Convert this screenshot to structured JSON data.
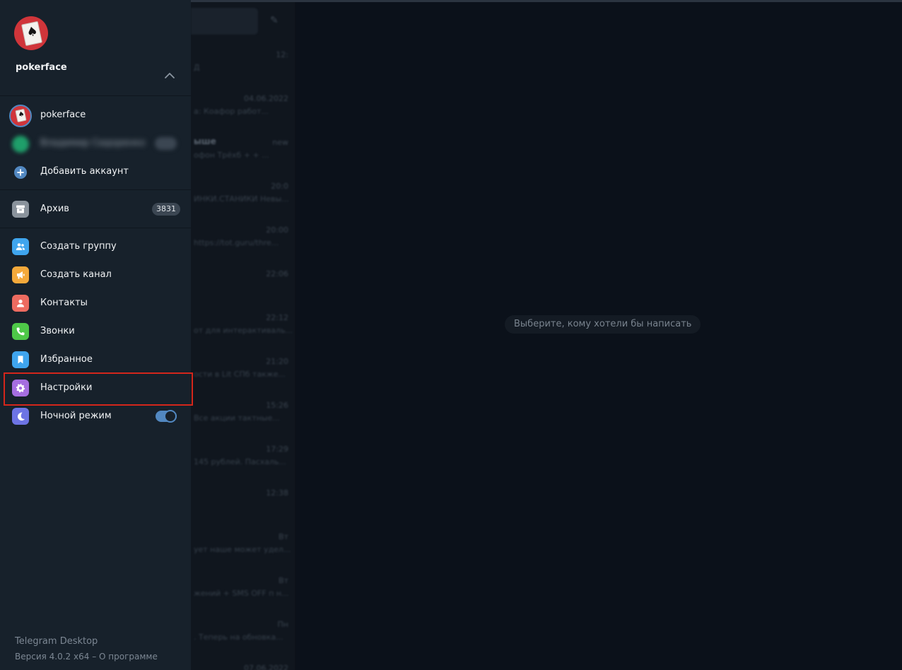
{
  "app": {
    "title": "Telegram Desktop"
  },
  "drawer": {
    "header": {
      "name": "pokerface"
    },
    "accounts": [
      {
        "name": "pokerface"
      },
      {
        "name": "Владимир Сидоренко",
        "badge": "288"
      }
    ],
    "add_account": "Добавить аккаунт",
    "archive": {
      "label": "Архив",
      "count": "3831"
    },
    "menu": {
      "new_group": "Создать группу",
      "new_channel": "Создать канал",
      "contacts": "Контакты",
      "calls": "Звонки",
      "saved": "Избранное",
      "settings": "Настройки",
      "night_mode": "Ночной режим"
    },
    "night_mode_on": true,
    "footer": {
      "title": "Telegram Desktop",
      "version_prefix": "Версия 4.0.2 x64 – ",
      "about": "О программе"
    }
  },
  "colors": {
    "accent": "#5288c1",
    "highlight_box": "#d4261b",
    "group_icon": "#3fa5ee",
    "channel_icon": "#f4a93b",
    "contacts_icon": "#ec6b60",
    "calls_icon": "#4ec848",
    "saved_icon": "#3fa5ee",
    "settings_icon": "#a66ee0",
    "night_icon": "#6d74e4"
  },
  "chatlist": {
    "rows": [
      {
        "time": "12:",
        "name": "",
        "preview": "Д"
      },
      {
        "time": "04.06.2022",
        "name": "",
        "preview": "а: Коафор работ..."
      },
      {
        "time": "new",
        "name": "ыше",
        "preview": "офон Трёхб  +  +  ..."
      },
      {
        "time": "20:0",
        "name": "",
        "preview": "ИНКИ.СТАНИКИ Невы..."
      },
      {
        "time": "20:00",
        "name": "",
        "preview": "https://tot.guru/thre..."
      },
      {
        "time": "22:06",
        "name": "",
        "preview": ""
      },
      {
        "time": "22:12",
        "name": "",
        "preview": "от для интерактиваль..."
      },
      {
        "time": "21:20",
        "name": "",
        "preview": "ости в Lit СПб также..."
      },
      {
        "time": "15:26",
        "name": "",
        "preview": "Все акции тактные..."
      },
      {
        "time": "17:29",
        "name": "",
        "preview": "145 рублей. Пасхаль..."
      },
      {
        "time": "12:38",
        "name": "",
        "preview": ""
      },
      {
        "time": "Вт",
        "name": "",
        "preview": "ует наше может удел..."
      },
      {
        "time": "Вт",
        "name": "",
        "preview": "жений + SMS OFF п н..."
      },
      {
        "time": "Пн",
        "name": "",
        "preview": ". Теперь на обновка..."
      },
      {
        "time": "07.06.2022",
        "name": "",
        "preview": ""
      }
    ]
  },
  "main": {
    "empty_hint": "Выберите, кому хотели бы написать"
  }
}
